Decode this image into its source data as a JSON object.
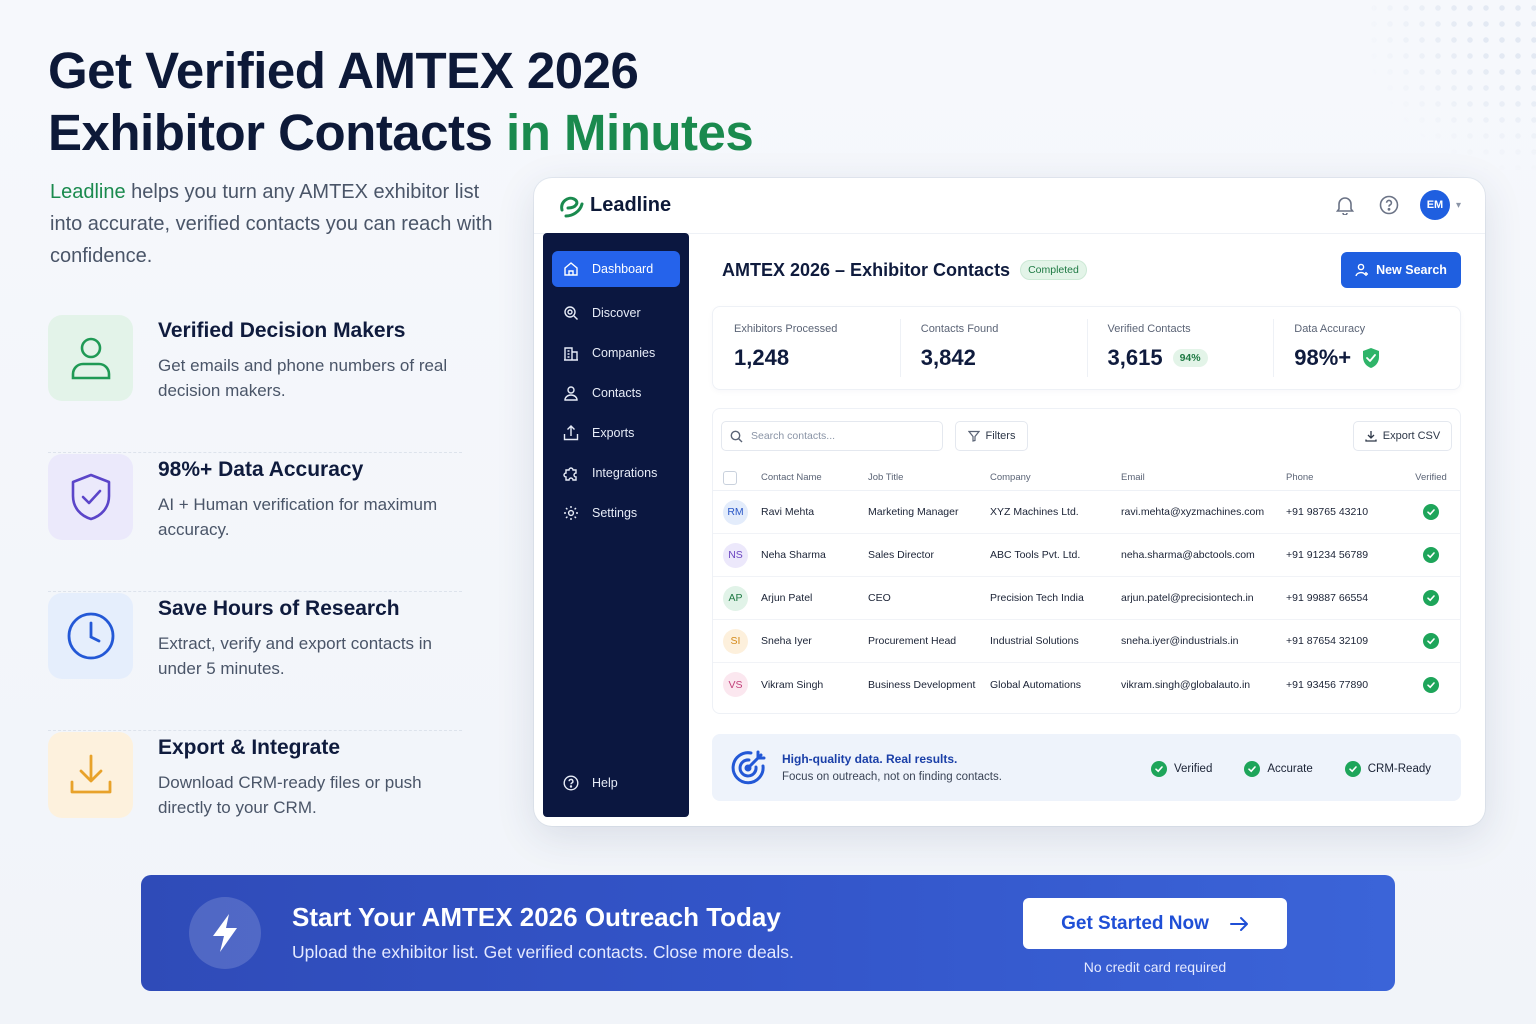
{
  "hero": {
    "title_line1": "Get Verified AMTEX 2026",
    "title_line2_main": "Exhibitor Contacts ",
    "title_line2_accent": "in Minutes",
    "brand": "Leadline",
    "subtitle": " helps you turn any AMTEX exhibitor list into accurate, verified contacts you can reach with confidence."
  },
  "features": [
    {
      "title": "Verified Decision Makers",
      "desc": "Get emails and phone numbers of real decision makers.",
      "icon": "user-icon"
    },
    {
      "title": "98%+ Data Accuracy",
      "desc": "AI + Human verification for maximum accuracy.",
      "icon": "shield-check-icon"
    },
    {
      "title": "Save Hours of Research",
      "desc": "Extract, verify and export contacts in under 5 minutes.",
      "icon": "clock-icon"
    },
    {
      "title": "Export & Integrate",
      "desc": "Download CRM-ready files or push directly to your CRM.",
      "icon": "download-icon"
    }
  ],
  "app": {
    "logo": "Leadline",
    "avatar": "EM",
    "nav": [
      "Dashboard",
      "Discover",
      "Companies",
      "Contacts",
      "Exports",
      "Integrations",
      "Settings"
    ],
    "help": "Help",
    "title": "AMTEX 2026 – Exhibitor Contacts",
    "status": "Completed",
    "new_search": "New Search",
    "stats": [
      {
        "label": "Exhibitors Processed",
        "value": "1,248"
      },
      {
        "label": "Contacts Found",
        "value": "3,842"
      },
      {
        "label": "Verified Contacts",
        "value": "3,615",
        "badge": "94%"
      },
      {
        "label": "Data Accuracy",
        "value": "98%+"
      }
    ],
    "search_placeholder": "Search contacts...",
    "filters": "Filters",
    "export_csv": "Export CSV",
    "columns": [
      "Contact Name",
      "Job Title",
      "Company",
      "Email",
      "Phone",
      "Verified"
    ],
    "rows": [
      {
        "initials": "RM",
        "name": "Ravi Mehta",
        "title": "Marketing Manager",
        "company": "XYZ Machines Ltd.",
        "email": "ravi.mehta@xyzmachines.com",
        "phone": "+91 98765 43210",
        "bg": "#e3ecfb",
        "fg": "#2a58c7"
      },
      {
        "initials": "NS",
        "name": "Neha Sharma",
        "title": "Sales Director",
        "company": "ABC Tools Pvt. Ltd.",
        "email": "neha.sharma@abctools.com",
        "phone": "+91 91234 56789",
        "bg": "#ece8fb",
        "fg": "#6b46c1"
      },
      {
        "initials": "AP",
        "name": "Arjun Patel",
        "title": "CEO",
        "company": "Precision Tech India",
        "email": "arjun.patel@precisiontech.in",
        "phone": "+91 99887 66554",
        "bg": "#e1f3e8",
        "fg": "#1f7a44"
      },
      {
        "initials": "SI",
        "name": "Sneha Iyer",
        "title": "Procurement Head",
        "company": "Industrial Solutions",
        "email": "sneha.iyer@industrials.in",
        "phone": "+91 87654 32109",
        "bg": "#fdf0dc",
        "fg": "#d48a1a"
      },
      {
        "initials": "VS",
        "name": "Vikram Singh",
        "title": "Business Development",
        "company": "Global Automations",
        "email": "vikram.singh@globalauto.in",
        "phone": "+91 93456 77890",
        "bg": "#fbe7ef",
        "fg": "#c2417a"
      }
    ],
    "banner_title": "High-quality data. Real results.",
    "banner_sub": "Focus on outreach, not on finding contacts.",
    "banner_checks": [
      "Verified",
      "Accurate",
      "CRM-Ready"
    ]
  },
  "cta": {
    "title": "Start Your AMTEX 2026 Outreach Today",
    "sub": "Upload the exhibitor list. Get verified contacts. Close more deals.",
    "button": "Get Started Now",
    "note": "No credit card required"
  },
  "colors": {
    "accent_green": "#1a8a4e",
    "primary_blue": "#1f5fe0",
    "sidebar_navy": "#0b1740",
    "verified_green": "#1ea55a"
  }
}
